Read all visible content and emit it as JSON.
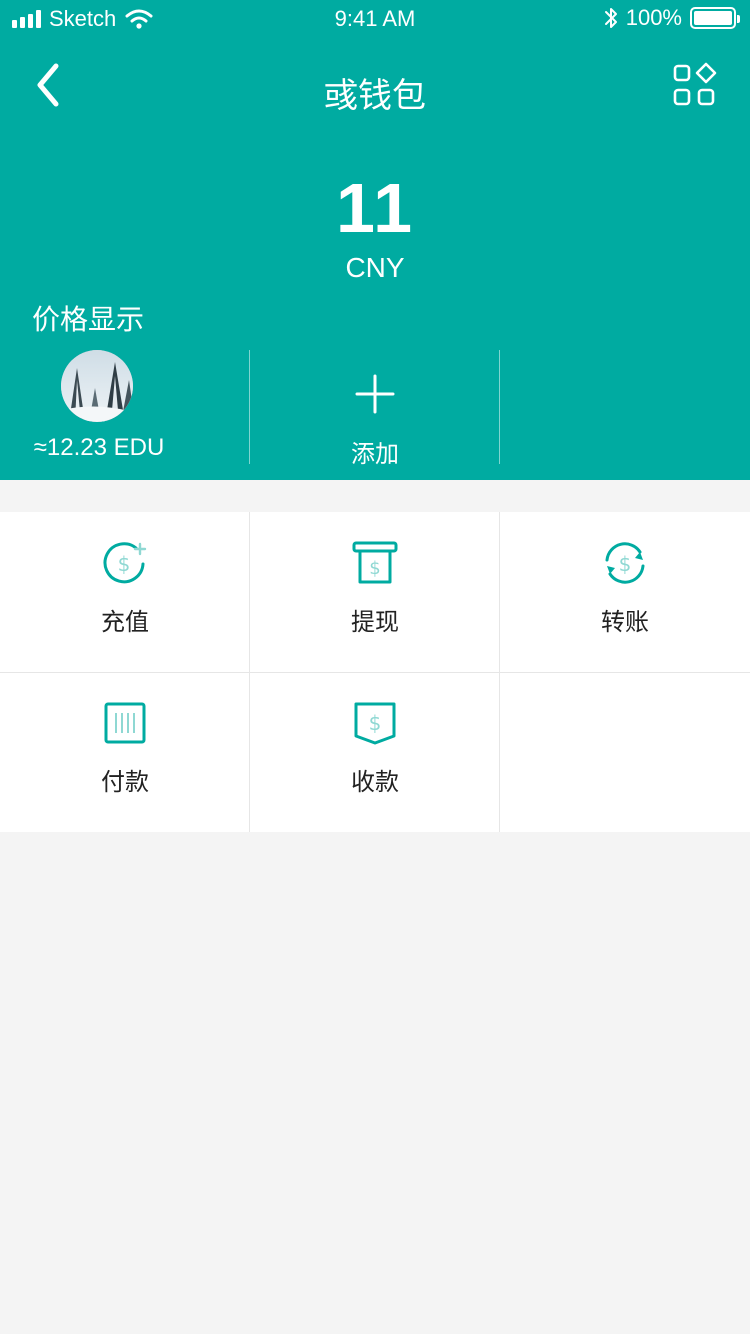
{
  "status_bar": {
    "carrier": "Sketch",
    "time": "9:41 AM",
    "battery": "100%"
  },
  "nav": {
    "title": "彧钱包"
  },
  "balance": {
    "amount": "11",
    "currency": "CNY"
  },
  "price_display_label": "价格显示",
  "tokens": [
    {
      "amount": "≈12.23 EDU"
    }
  ],
  "add_label": "添加",
  "actions": [
    {
      "label": "充值",
      "icon": "recharge-icon"
    },
    {
      "label": "提现",
      "icon": "withdraw-icon"
    },
    {
      "label": "转账",
      "icon": "transfer-icon"
    },
    {
      "label": "付款",
      "icon": "pay-icon"
    },
    {
      "label": "收款",
      "icon": "receive-icon"
    }
  ],
  "colors": {
    "primary": "#00aba1",
    "icon_light": "#8fd8d3",
    "background": "#f4f4f4"
  }
}
